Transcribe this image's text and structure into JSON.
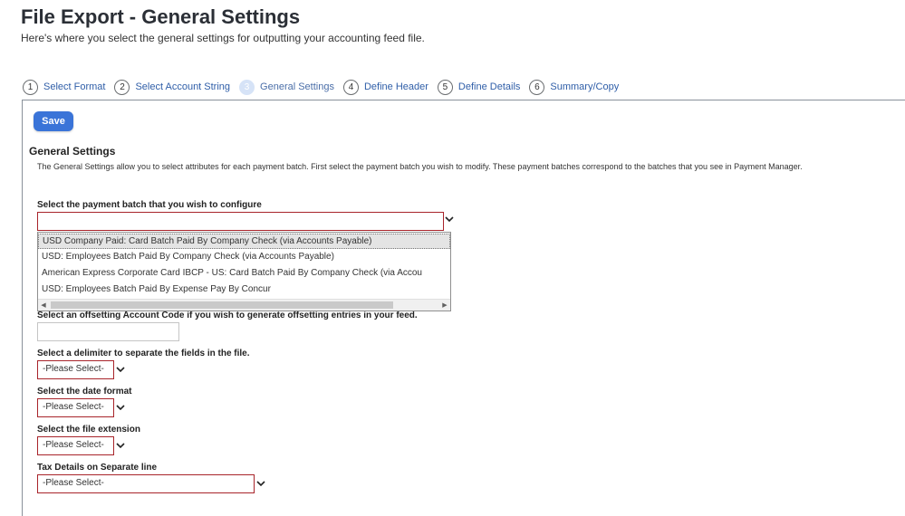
{
  "page": {
    "title": "File Export - General Settings",
    "subtitle": "Here's where you select the general settings for outputting your accounting feed file."
  },
  "steps": [
    {
      "num": "1",
      "label": "Select Format"
    },
    {
      "num": "2",
      "label": "Select Account String"
    },
    {
      "num": "3",
      "label": "General Settings",
      "active": true
    },
    {
      "num": "4",
      "label": "Define Header"
    },
    {
      "num": "5",
      "label": "Define Details"
    },
    {
      "num": "6",
      "label": "Summary/Copy"
    }
  ],
  "toolbar": {
    "save_label": "Save"
  },
  "section": {
    "title": "General Settings",
    "description": "The General Settings allow you to select attributes for each payment batch. First select the payment batch you wish to modify. These payment batches correspond to the batches that you see in Payment Manager."
  },
  "fields": {
    "payment_batch": {
      "label": "Select the payment batch that you wish to configure",
      "value": "",
      "options": [
        "USD Company Paid: Card Batch Paid By Company Check (via Accounts Payable)",
        "USD: Employees Batch Paid By Company Check (via Accounts Payable)",
        "American Express Corporate Card IBCP - US: Card Batch Paid By Company Check (via Accou",
        "USD: Employees Batch Paid By Expense Pay By Concur"
      ]
    },
    "offset_account": {
      "label": "Select an offsetting Account Code if you wish to generate offsetting entries in your feed.",
      "value": ""
    },
    "delimiter": {
      "label": "Select a delimiter to separate the fields in the file.",
      "value": "-Please Select-"
    },
    "date_format": {
      "label": "Select the date format",
      "value": "-Please Select-"
    },
    "file_extension": {
      "label": "Select the file extension",
      "value": "-Please Select-"
    },
    "tax_details": {
      "label": "Tax Details on Separate line",
      "value": "-Please Select-"
    }
  },
  "colors": {
    "accent": "#3a74d8",
    "link": "#2f5ea8",
    "required_border": "#a8242a"
  },
  "icons": {
    "chevron": "chevron-down-icon",
    "scroll_left": "triangle-left",
    "scroll_right": "triangle-right"
  }
}
